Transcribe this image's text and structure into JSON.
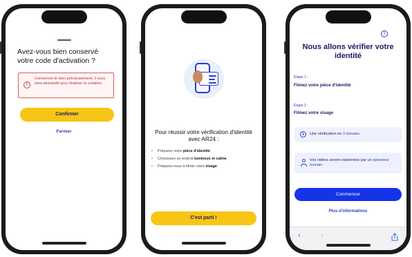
{
  "screen1": {
    "title": "Avez-vous bien conservé votre code d'activation ?",
    "alert_text": "Conservez-le bien précieusement, il vous sera demandé pour finaliser la création.",
    "alert_icon": "exclamation-circle-icon",
    "confirm_label": "Confirmer",
    "close_label": "Fermer"
  },
  "screen2": {
    "title": "Pour réussir votre vérification d'identité avec AR24 :",
    "steps": [
      {
        "text": "Préparez votre ",
        "bold": "pièce d'identité"
      },
      {
        "text": "Choisissez un endroit ",
        "bold": "lumineux et calme"
      },
      {
        "text": "Préparez-vous à filmer votre ",
        "bold": "visage"
      }
    ],
    "start_label": "C'est parti !",
    "illustration_icon": "phone-id-card-icon"
  },
  "screen3": {
    "title": "Nous allons vérifier votre identité",
    "step1_label": "Étape 1 :",
    "step1_value": "Filmez votre pièce d'identité",
    "step2_label": "Étape 2 :",
    "step2_value": "Filmez votre visage",
    "card1_text": "Une vérification en ",
    "card1_highlight": "3 minutes",
    "card2_text": "Vos vidéos seront visionnées par un ",
    "card2_highlight": "opérateur humain",
    "start_label": "Commencer",
    "more_label": "Plus d'informations",
    "browser": {
      "back": "‹",
      "forward": "›",
      "share": "share-icon"
    }
  },
  "colors": {
    "yellow": "#f7c515",
    "blue": "#1633e8",
    "navy": "#1a1a66",
    "alert_red": "#c42b2b"
  }
}
